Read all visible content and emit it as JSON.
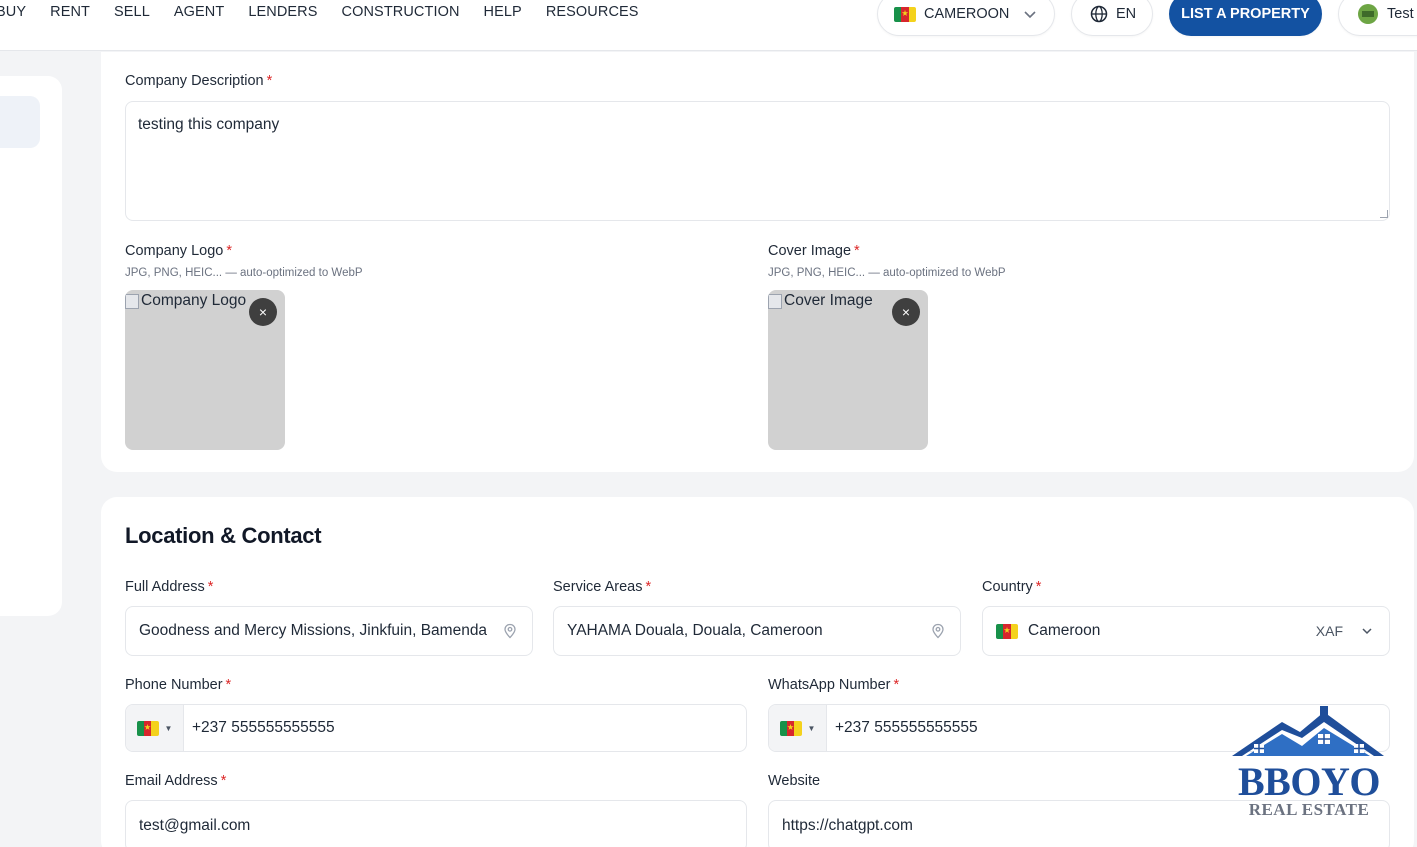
{
  "nav": {
    "links": [
      "BUY",
      "RENT",
      "SELL",
      "AGENT",
      "LENDERS",
      "CONSTRUCTION",
      "HELP",
      "RESOURCES"
    ],
    "country": "CAMEROON",
    "language": "EN",
    "cta": "LIST A PROPERTY",
    "user": "Test"
  },
  "company": {
    "description_label": "Company Description",
    "description_value": "testing this company",
    "logo_label": "Company Logo",
    "logo_hint": "JPG, PNG, HEIC... — auto-optimized to WebP",
    "logo_alt": "Company Logo",
    "cover_label": "Cover Image",
    "cover_hint": "JPG, PNG, HEIC... — auto-optimized to WebP",
    "cover_alt": "Cover Image",
    "remove_symbol": "×"
  },
  "location": {
    "title": "Location & Contact",
    "address_label": "Full Address",
    "address_value": "Goodness and Mercy Missions, Jinkfuin, Bamenda",
    "service_label": "Service Areas",
    "service_value": "YAHAMA Douala, Douala, Cameroon",
    "country_label": "Country",
    "country_value": "Cameroon",
    "currency": "XAF",
    "phone_label": "Phone Number",
    "phone_value": "+237 555555555555",
    "whatsapp_label": "WhatsApp Number",
    "whatsapp_value": "+237 555555555555",
    "email_label": "Email Address",
    "email_value": "test@gmail.com",
    "website_label": "Website",
    "website_value": "https://chatgpt.com"
  },
  "required_marker": "*",
  "watermark": {
    "brand": "BBOYO",
    "tagline": "REAL ESTATE"
  },
  "colors": {
    "primary": "#1352a2",
    "required": "#dc2626",
    "placeholder_image": "#d1d1d1"
  }
}
